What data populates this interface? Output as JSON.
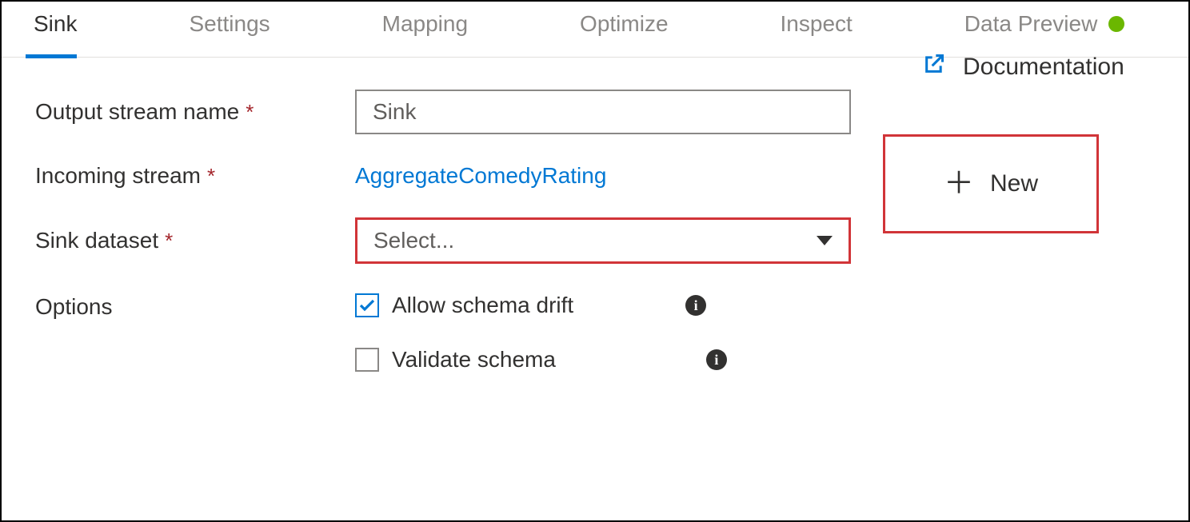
{
  "tabs": {
    "sink": "Sink",
    "settings": "Settings",
    "mapping": "Mapping",
    "optimize": "Optimize",
    "inspect": "Inspect",
    "dataPreview": "Data Preview"
  },
  "labels": {
    "outputStreamName": "Output stream name",
    "incomingStream": "Incoming stream",
    "sinkDataset": "Sink dataset",
    "options": "Options"
  },
  "fields": {
    "outputStreamName": "Sink",
    "incomingStream": "AggregateComedyRating",
    "sinkDatasetPlaceholder": "Select..."
  },
  "options": {
    "allowSchemaDrift": "Allow schema drift",
    "validateSchema": "Validate schema"
  },
  "actions": {
    "new": "New",
    "documentation": "Documentation"
  },
  "required_marker": "*"
}
